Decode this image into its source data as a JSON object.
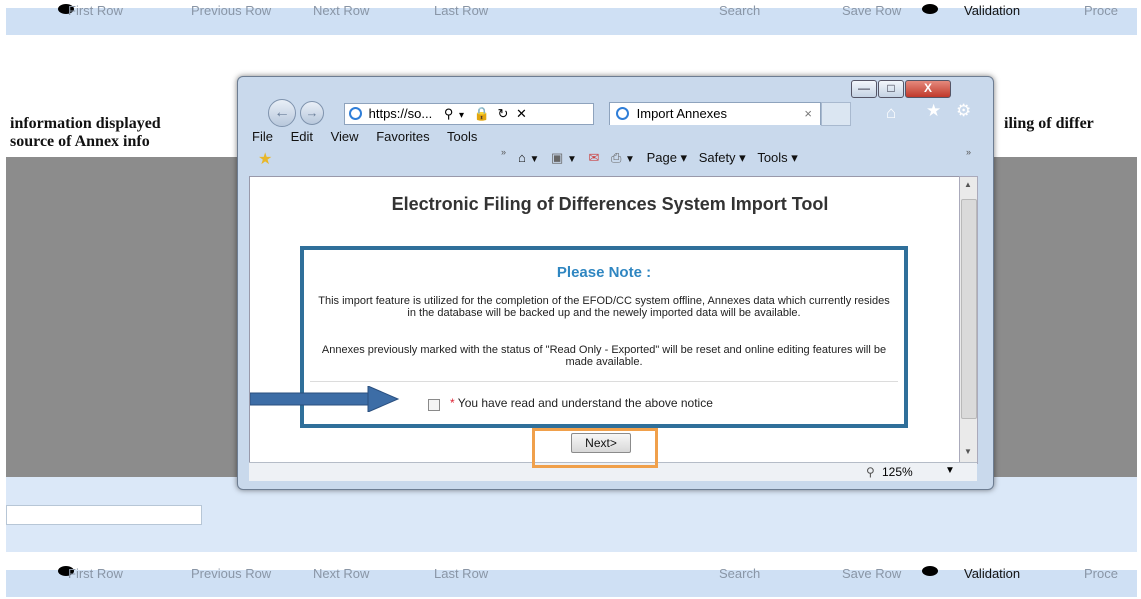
{
  "background_page": {
    "nav_top": {
      "first_row": "First Row",
      "previous_row": "Previous Row",
      "next_row": "Next Row",
      "last_row": "Last Row",
      "search": "Search",
      "save_row": "Save Row",
      "validation": "Validation",
      "process": "Proce"
    },
    "nav_bottom": {
      "first_row": "First Row",
      "previous_row": "Previous Row",
      "next_row": "Next Row",
      "last_row": "Last Row",
      "search": "Search",
      "save_row": "Save Row",
      "validation": "Validation",
      "process": "Proce"
    },
    "text_line1_left": "information displayed",
    "text_line2_left": "source of Annex info",
    "text_line1_right": "iling of differ",
    "input_value": ""
  },
  "browser": {
    "address_url": "https://so...",
    "tab_title": "Import Annexes",
    "menu": [
      "File",
      "Edit",
      "View",
      "Favorites",
      "Tools"
    ],
    "toolbar": {
      "page": "Page",
      "safety": "Safety",
      "tools": "Tools"
    },
    "zoom": "125%",
    "window_buttons": {
      "minimize": "—",
      "maximize": "□",
      "close": "X"
    }
  },
  "dialog": {
    "title": "Electronic Filing of Differences System Import Tool",
    "notice_title": "Please Note :",
    "paragraph1": "This import feature is utilized for the completion of the EFOD/CC system offline, Annexes data which currently resides in the database will be backed up and the newely imported data will be available.",
    "paragraph2": "Annexes previously marked with the status of \"Read Only - Exported\" will be reset and online editing features will be made available.",
    "required_marker": "*",
    "checkbox_label": "You have read and understand the above notice",
    "checkbox_checked": false,
    "next_button": "Next>"
  },
  "colors": {
    "arrow": "#3d6da6",
    "highlight_box": "#f0a04b",
    "notice_border": "#2f6f9a",
    "notice_title": "#2f86c1"
  }
}
